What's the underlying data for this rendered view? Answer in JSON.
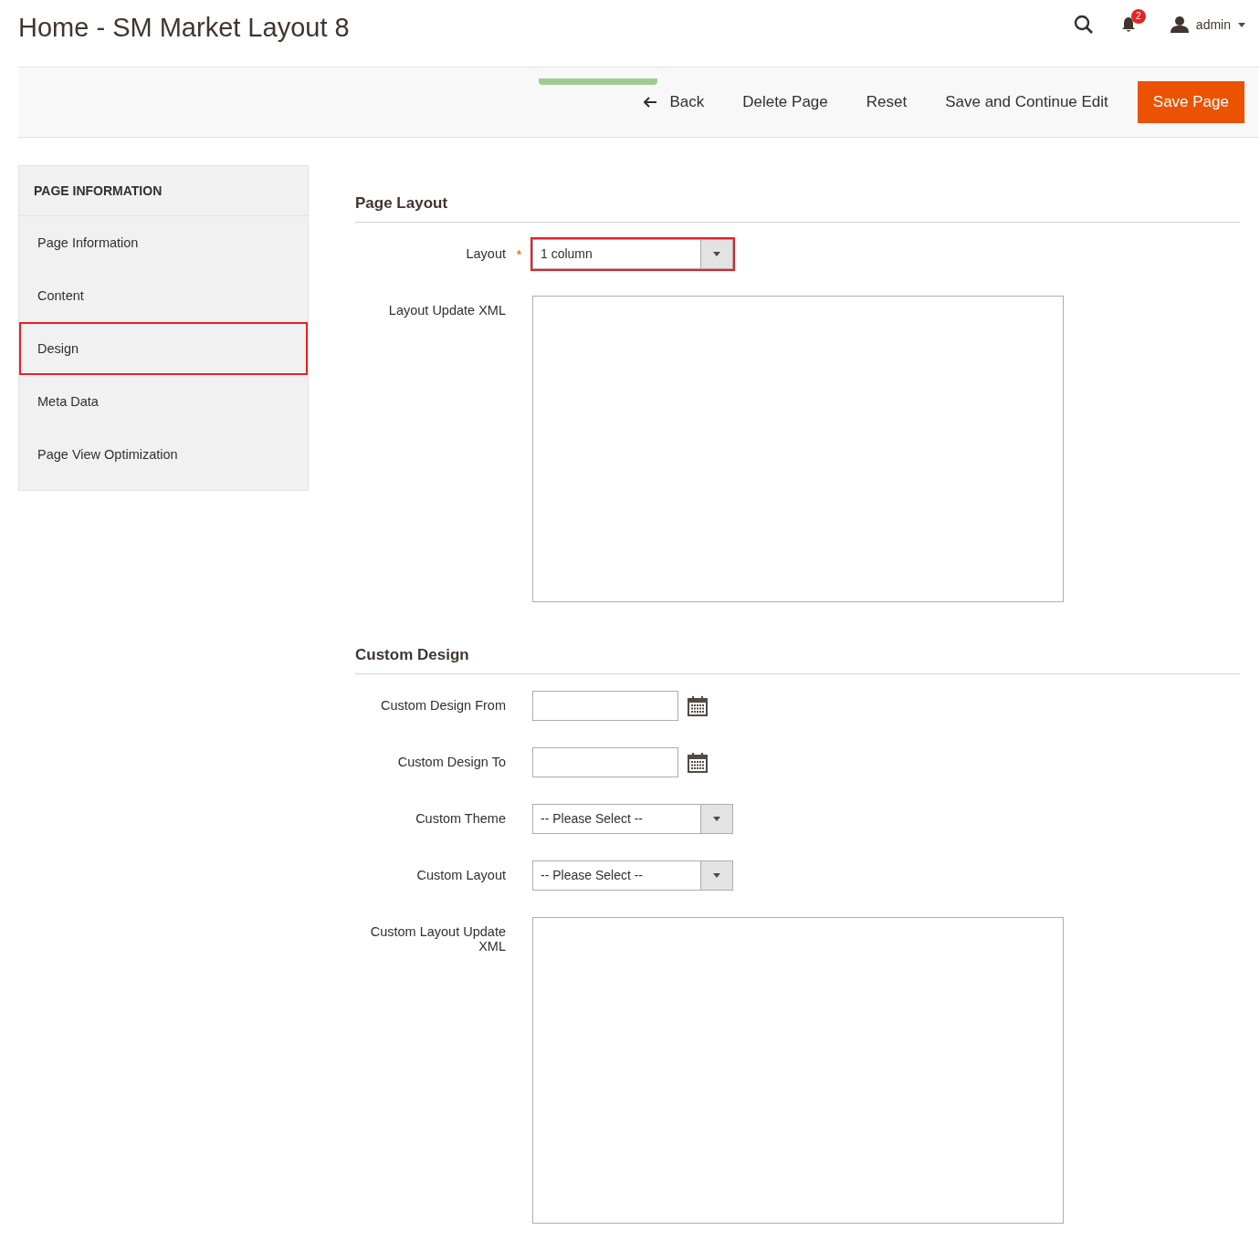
{
  "header": {
    "title": "Home - SM Market Layout 8",
    "notifications": "2",
    "user": "admin"
  },
  "toolbar": {
    "buttons": [
      {
        "label": "Back",
        "kind": "back"
      },
      {
        "label": "Delete Page",
        "kind": "plain"
      },
      {
        "label": "Reset",
        "kind": "plain"
      },
      {
        "label": "Save and Continue Edit",
        "kind": "plain"
      },
      {
        "label": "Save Page",
        "kind": "primary"
      }
    ]
  },
  "sidebar": {
    "title": "PAGE INFORMATION",
    "items": [
      {
        "label": "Page Information",
        "selected": false
      },
      {
        "label": "Content",
        "selected": false
      },
      {
        "label": "Design",
        "selected": true
      },
      {
        "label": "Meta Data",
        "selected": false
      },
      {
        "label": "Page View Optimization",
        "selected": false
      }
    ]
  },
  "sections": [
    {
      "title": "Page Layout",
      "fields": [
        {
          "label": "Layout",
          "kind": "select",
          "required_mark": "*",
          "highlighted": true,
          "value": "1 column"
        },
        {
          "label": "Layout Update XML",
          "kind": "textarea",
          "highlighted": false
        }
      ]
    },
    {
      "title": "Custom Design",
      "fields": [
        {
          "label": "Custom Design From",
          "kind": "date",
          "highlighted": false
        },
        {
          "label": "Custom Design To",
          "kind": "date",
          "highlighted": false
        },
        {
          "label": "Custom Theme",
          "kind": "select",
          "highlighted": false,
          "value": "-- Please Select --"
        },
        {
          "label": "Custom Layout",
          "kind": "select",
          "highlighted": false,
          "value": "-- Please Select --"
        },
        {
          "label": "Custom Layout Update XML",
          "kind": "textarea",
          "highlighted": false
        }
      ]
    }
  ]
}
